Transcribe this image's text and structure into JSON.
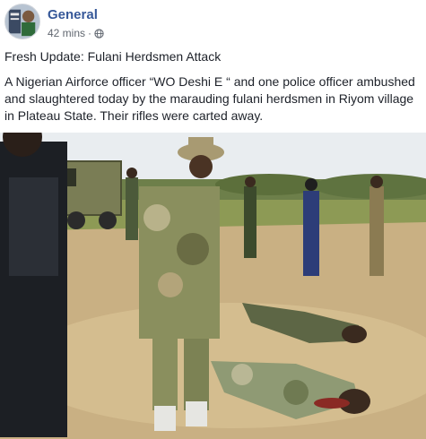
{
  "post": {
    "author": "General",
    "timestamp": "42 mins",
    "separator": "·",
    "privacy_icon": "globe-icon",
    "headline": "Fresh Update: Fulani Herdsmen Attack",
    "body": "A Nigerian Airforce officer “WO Deshi E “ and one police officer ambushed and slaughtered today by the marauding fulani herdsmen in Riyom village in Plateau State. Their rifles were carted away."
  },
  "colors": {
    "author_link": "#365899",
    "meta_text": "#616770",
    "body_text": "#1d2129"
  }
}
